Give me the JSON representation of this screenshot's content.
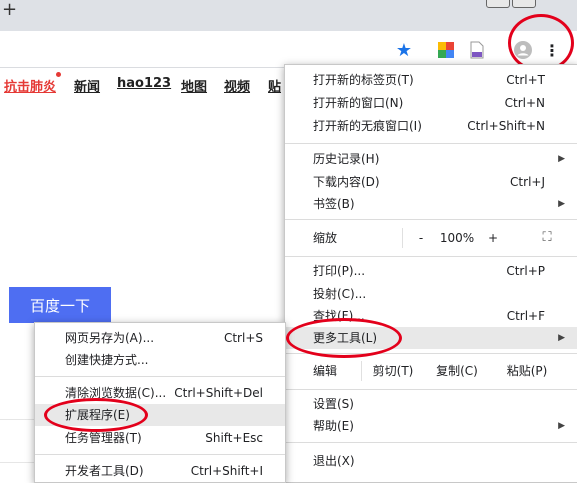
{
  "tabstrip": {
    "new_tab_glyph": "+"
  },
  "toolbar": {
    "icons": [
      "bookmark-star-icon",
      "extension-green-icon",
      "extension-purple-icon",
      "profile-icon",
      "kebab-menu-icon"
    ],
    "menu_glyph": "⋮",
    "star_glyph": "★"
  },
  "nav": {
    "links": [
      "抗击肺炎",
      "新闻",
      "hao123",
      "地图",
      "视频",
      "贴"
    ]
  },
  "search": {
    "button_label": "百度一下"
  },
  "main_menu": {
    "items": {
      "new_tab": {
        "label": "打开新的标签页(T)",
        "shortcut": "Ctrl+T"
      },
      "new_window": {
        "label": "打开新的窗口(N)",
        "shortcut": "Ctrl+N"
      },
      "incognito": {
        "label": "打开新的无痕窗口(I)",
        "shortcut": "Ctrl+Shift+N"
      },
      "history": {
        "label": "历史记录(H)"
      },
      "downloads": {
        "label": "下载内容(D)",
        "shortcut": "Ctrl+J"
      },
      "bookmarks": {
        "label": "书签(B)"
      },
      "zoom": {
        "label": "缩放",
        "minus": "-",
        "value": "100%",
        "plus": "+",
        "fullscreen": "⛶"
      },
      "print": {
        "label": "打印(P)...",
        "shortcut": "Ctrl+P"
      },
      "cast": {
        "label": "投射(C)..."
      },
      "find": {
        "label": "查找(F)...",
        "shortcut": "Ctrl+F"
      },
      "more_tools": {
        "label": "更多工具(L)"
      },
      "edit": {
        "label": "编辑",
        "cut": "剪切(T)",
        "copy": "复制(C)",
        "paste": "粘贴(P)"
      },
      "settings": {
        "label": "设置(S)"
      },
      "help": {
        "label": "帮助(E)"
      },
      "exit": {
        "label": "退出(X)"
      }
    },
    "arrow_glyph": "▶"
  },
  "submenu": {
    "items": {
      "save_as": {
        "label": "网页另存为(A)...",
        "shortcut": "Ctrl+S"
      },
      "create_shortcut": {
        "label": "创建快捷方式..."
      },
      "clear_data": {
        "label": "清除浏览数据(C)...",
        "shortcut": "Ctrl+Shift+Del"
      },
      "extensions": {
        "label": "扩展程序(E)"
      },
      "task_manager": {
        "label": "任务管理器(T)",
        "shortcut": "Shift+Esc"
      },
      "dev_tools": {
        "label": "开发者工具(D)",
        "shortcut": "Ctrl+Shift+I"
      }
    }
  },
  "colors": {
    "annotation_red": "#e3001b",
    "highlight": "#e8e8e8",
    "search_blue": "#4e6ef2"
  }
}
